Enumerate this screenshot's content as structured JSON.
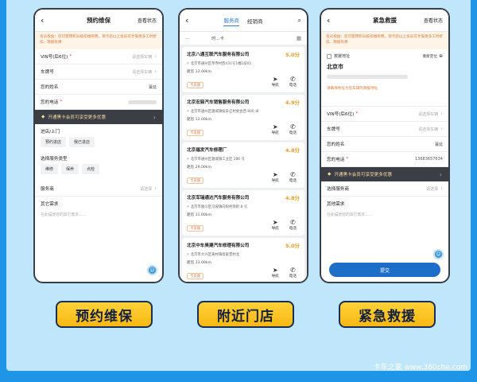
{
  "phone1": {
    "back": "‹",
    "title": "预约维保",
    "action": "查看状态",
    "notice": "会员权益：您可使用积分抵扣维修费，领卡后以上会员可享受更多工时折扣、救援优惠",
    "fields": {
      "vin_label": "VIN号(后6位)",
      "vin_value": "请选择车辆",
      "plate_label": "车牌号",
      "plate_value": "请选择车辆",
      "name_label": "您的姓名",
      "name_value": "蔓延",
      "phone_label": "您的电话"
    },
    "vip": "开通黑卡会员可享受更多优惠",
    "mode_label": "进店/上门",
    "modes": [
      "预约进店",
      "我已进店"
    ],
    "service_label": "选择服务类型",
    "services": [
      "维修",
      "保养",
      "点检"
    ],
    "merchant_label": "服务商",
    "merchant_value": "请选择",
    "other_label": "其它需求",
    "other_placeholder": "在此描述您的其它需求……"
  },
  "phone2": {
    "back": "‹",
    "tab_active": "服务商",
    "tab_other": "经销商",
    "filter_a": "…",
    "filter_b": "时…卡",
    "nav_label": "导航",
    "call_label": "电话",
    "stores": [
      {
        "name": "北京八通互联汽车服务有限公司",
        "score": "5.0分",
        "addr": "北京市通州区草寺村西431号1幢1层01",
        "dist": "距您 12.00km",
        "tag": "卡友援"
      },
      {
        "name": "北京宏驿汽车销售服务有限公司",
        "score": "4.9分",
        "addr": "北京市通州区潞城镇侯辛庄村委会西 800 米",
        "dist": "距您 12.00km",
        "tag": "卡友援"
      },
      {
        "name": "北京福发汽车修理厂",
        "score": "4.8分",
        "addr": "北京市通州区潞城镇工业区 286 号",
        "dist": "距您 29.00km",
        "tag": "卡友援"
      },
      {
        "name": "北京军瑞通达汽车服务有限公司",
        "score": "4.8分",
        "addr": "北京市顺义区马坡镇向阳村南街 8 号",
        "dist": "距您 31.00km",
        "tag": "卡友援"
      },
      {
        "name": "北京中车昊建汽车修理有限公司",
        "score": "5.0分",
        "addr": "北京市大兴区黄村镇高家堡村北",
        "dist": "距您 33.00km",
        "tag": "卡友援"
      }
    ]
  },
  "phone3": {
    "back": "‹",
    "title": "紧急救援",
    "action": "查看状态",
    "notice": "会员权益：您可使用积分抵扣维修费，领卡后以上会员可享受更多工时折扣、救援优惠",
    "loc_label": "救援地址",
    "relocate": "重新定位",
    "city": "北京市",
    "loc_tip": "请确保地址为您车辆的救援地址",
    "fields": {
      "vin_label": "VIN号(后6位)",
      "vin_value": "请选择车辆",
      "plate_label": "车牌号",
      "plate_value": "请选择车辆",
      "name_label": "您的姓名",
      "name_value": "蔓延",
      "phone_label": "您的电话",
      "phone_value": "13683657634"
    },
    "vip": "开通黑卡会员可享受更多优惠",
    "merchant_label": "选择服务商",
    "merchant_value": "请选择",
    "other_label": "其他需求",
    "other_placeholder": "在此描述您的其它需求……",
    "submit": "提交"
  },
  "captions": [
    "预约维保",
    "附近门店",
    "紧急救援"
  ],
  "watermark": "卡车之家 www.360che.com",
  "colors": {
    "background": "#1f95e8",
    "panel": "#bfe6fb",
    "accent": "#2d7fd8",
    "caption": "#f8b812",
    "score": "#f19b23"
  }
}
